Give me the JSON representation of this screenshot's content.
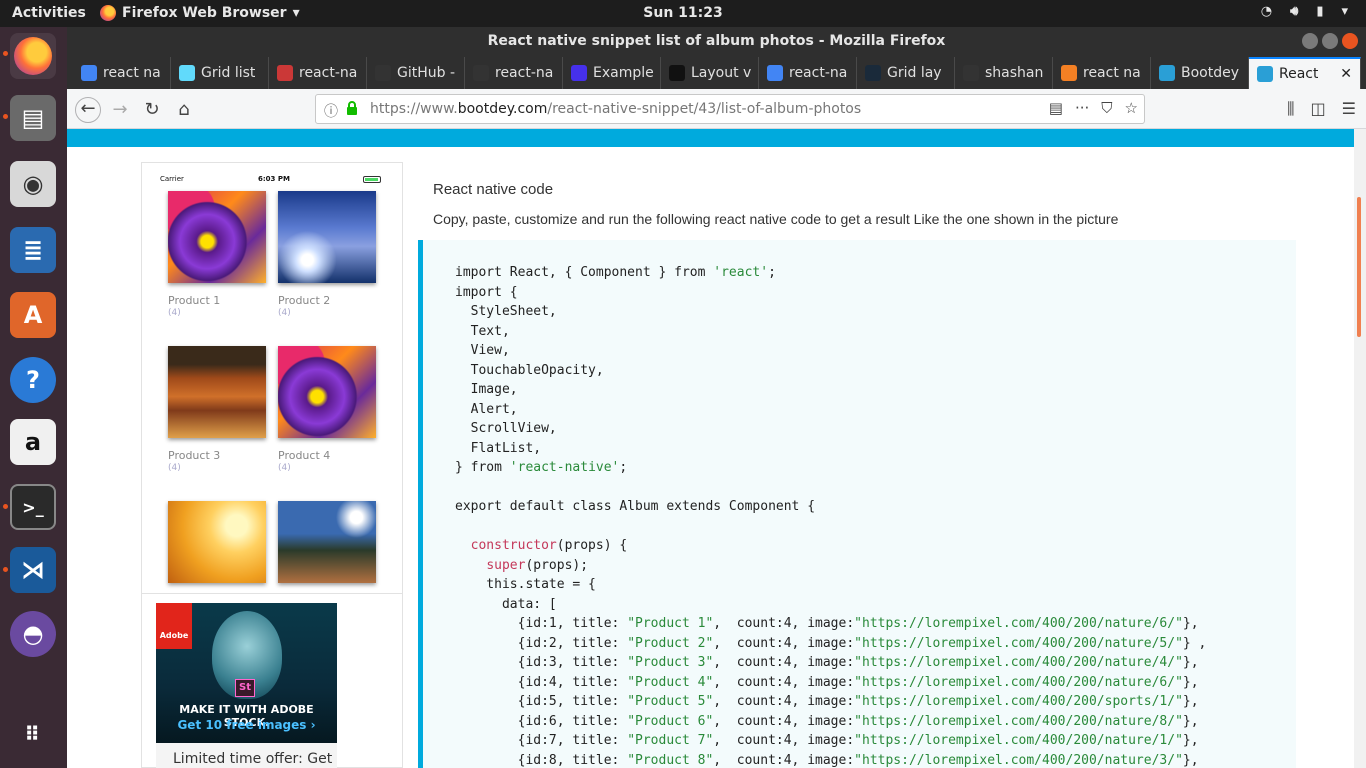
{
  "system_bar": {
    "activities": "Activities",
    "app_name": "Firefox Web Browser",
    "clock": "Sun 11:23"
  },
  "window": {
    "title": "React native snippet list of album photos - Mozilla Firefox"
  },
  "tabs": [
    {
      "label": "react na",
      "icon": "google-icon",
      "color": "#4285f4"
    },
    {
      "label": "Grid list",
      "icon": "react-icon",
      "color": "#61dafb"
    },
    {
      "label": "react-na",
      "icon": "npm-icon",
      "color": "#cb3837"
    },
    {
      "label": "GitHub -",
      "icon": "github-icon",
      "color": "#333333"
    },
    {
      "label": "react-na",
      "icon": "github-icon",
      "color": "#333333"
    },
    {
      "label": "Example",
      "icon": "expo-icon",
      "color": "#4630eb"
    },
    {
      "label": "Layout v",
      "icon": "layout-icon",
      "color": "#111111"
    },
    {
      "label": "react-na",
      "icon": "google-icon",
      "color": "#4285f4"
    },
    {
      "label": "Grid lay",
      "icon": "circle-icon",
      "color": "#1a2a3a"
    },
    {
      "label": "shashan",
      "icon": "github-icon",
      "color": "#333333"
    },
    {
      "label": "react na",
      "icon": "stackoverflow-icon",
      "color": "#f48024"
    },
    {
      "label": "Bootdey",
      "icon": "bootdey-icon",
      "color": "#2a9fd6"
    },
    {
      "label": "React",
      "icon": "bootdey-icon",
      "color": "#2a9fd6",
      "active": true
    }
  ],
  "navbar": {
    "url_prefix": "https://www.",
    "url_domain": "bootdey.com",
    "url_path": "/react-native-snippet/43/list-of-album-photos"
  },
  "phone": {
    "carrier": "Carrier",
    "time": "6:03 PM",
    "products": [
      {
        "label": "Product 1",
        "count": "(4)"
      },
      {
        "label": "Product 2",
        "count": "(4)"
      },
      {
        "label": "Product 3",
        "count": "(4)"
      },
      {
        "label": "Product 4",
        "count": "(4)"
      }
    ]
  },
  "ad": {
    "brand": "Adobe",
    "badge": "St",
    "headline": "MAKE IT WITH ADOBE STOCK.",
    "cta": "Get 10 free images ›",
    "offer": "Limited time offer: Get"
  },
  "article": {
    "heading": "React native code",
    "description": "Copy, paste, customize and run the following react native code to get a result Like the one shown in the picture"
  },
  "code_lines": [
    "import React, { Component } from 'react';",
    "import {",
    "  StyleSheet,",
    "  Text,",
    "  View,",
    "  TouchableOpacity,",
    "  Image,",
    "  Alert,",
    "  ScrollView,",
    "  FlatList,",
    "} from 'react-native';",
    "",
    "export default class Album extends Component {",
    "",
    "  constructor(props) {",
    "    super(props);",
    "    this.state = {",
    "      data: [",
    "        {id:1, title: \"Product 1\",  count:4, image:\"https://lorempixel.com/400/200/nature/6/\"},",
    "        {id:2, title: \"Product 2\",  count:4, image:\"https://lorempixel.com/400/200/nature/5/\"} ,",
    "        {id:3, title: \"Product 3\",  count:4, image:\"https://lorempixel.com/400/200/nature/4/\"},",
    "        {id:4, title: \"Product 4\",  count:4, image:\"https://lorempixel.com/400/200/nature/6/\"},",
    "        {id:5, title: \"Product 5\",  count:4, image:\"https://lorempixel.com/400/200/sports/1/\"},",
    "        {id:6, title: \"Product 6\",  count:4, image:\"https://lorempixel.com/400/200/nature/8/\"},",
    "        {id:7, title: \"Product 7\",  count:4, image:\"https://lorempixel.com/400/200/nature/1/\"},",
    "        {id:8, title: \"Product 8\",  count:4, image:\"https://lorempixel.com/400/200/nature/3/\"},"
  ],
  "colors": {
    "accent": "#00aadd",
    "ubuntu_orange": "#e95420",
    "firefox_blue": "#0a84ff"
  }
}
